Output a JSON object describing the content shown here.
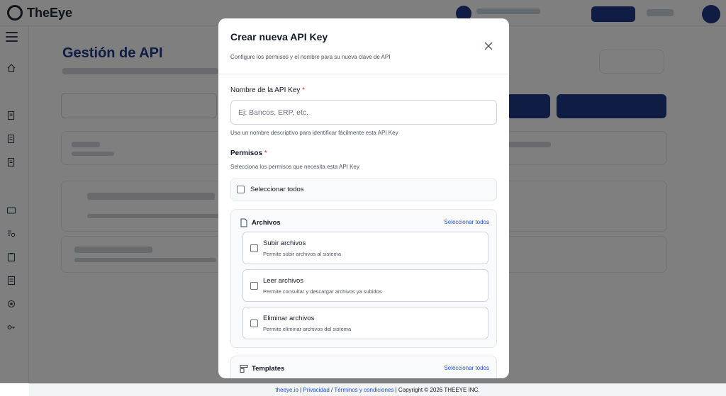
{
  "app": {
    "logo_text": "TheEye"
  },
  "background": {
    "page_title": "Gestión de API"
  },
  "footer": {
    "site": "theeye.io",
    "sep1": " | ",
    "privacy": "Privacidad",
    "sep2": " / ",
    "terms": "Términos y condiciones",
    "copyright": " | Copyright © 2026 THEEYE INC."
  },
  "modal": {
    "title": "Crear nueva API Key",
    "description": "Configure los permisos y el nombre para su nueva clave de API",
    "name_field": {
      "label": "Nombre de la API Key",
      "required_mark": "*",
      "placeholder": "Ej: Bancos, ERP, etc.",
      "value": "",
      "hint": "Usa un nombre descriptivo para identificar fácilmente esta API Key"
    },
    "permissions": {
      "label": "Permisos",
      "required_mark": "*",
      "hint": "Selecciona los permisos que necesita esta API Key",
      "select_all_label": "Seleccionar todos",
      "groups": [
        {
          "title": "Archivos",
          "icon": "file-icon",
          "select_all_link": "Seleccionar todos",
          "items": [
            {
              "title": "Subir archivos",
              "description": "Permite subir archivos al sistema",
              "checked": false
            },
            {
              "title": "Leer archivos",
              "description": "Permite consultar y descargar archivos ya subidos",
              "checked": false
            },
            {
              "title": "Eliminar archivos",
              "description": "Permite eliminar archivos del sistema",
              "checked": false
            }
          ]
        },
        {
          "title": "Templates",
          "icon": "template-icon",
          "select_all_link": "Seleccionar todos",
          "items": []
        }
      ]
    }
  }
}
